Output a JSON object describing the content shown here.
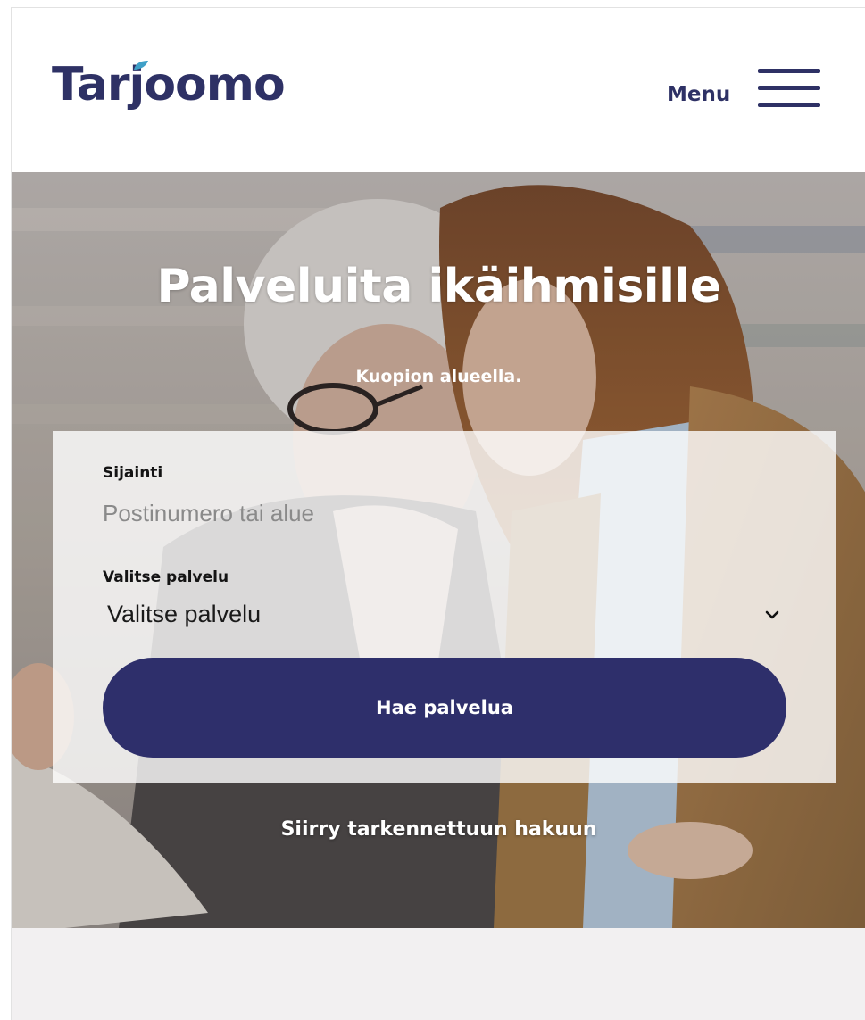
{
  "header": {
    "logo_text": "Tarjoomo",
    "menu_label": "Menu",
    "brand_color": "#2e3165",
    "leaf_color": "#3fa0c8"
  },
  "hero": {
    "title": "Palveluita ikäihmisille",
    "subtitle": "Kuopion alueella.",
    "background_image": "photo-elderly-woman-and-young-woman-shopping"
  },
  "search": {
    "location_label": "Sijainti",
    "location_placeholder": "Postinumero tai alue",
    "location_value": "",
    "service_label": "Valitse palvelu",
    "service_selected": "Valitse palvelu",
    "submit_label": "Hae palvelua",
    "button_color": "#2e2f6b"
  },
  "advanced_search_link": "Siirry tarkennettuun hakuun"
}
